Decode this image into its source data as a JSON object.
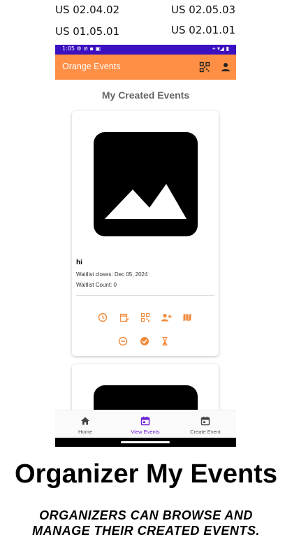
{
  "requirements": [
    "US 02.04.02",
    "US 02.05.03",
    "US 01.05.01",
    "US 02.01.01"
  ],
  "statusbar": {
    "time": "1:05",
    "left_icons": "⚙ ⊘ ▪ ▣",
    "right_icons": "⌖ ▾◢ ▮"
  },
  "appbar": {
    "title": "Orange Events",
    "qr_icon": "qr-code-icon",
    "profile_icon": "person-icon",
    "color": "#ff8f45"
  },
  "page": {
    "heading": "My Created Events"
  },
  "events": [
    {
      "name": "hi",
      "waitlist_closes": "Waitlist closes: Dec 05, 2024",
      "waitlist_count": "Waitlist Count: 0"
    }
  ],
  "actions": [
    "clock-icon",
    "edit-calendar-icon",
    "qr-code-icon",
    "add-person-icon",
    "map-icon",
    "remove-circle-icon",
    "check-circle-icon",
    "hourglass-icon"
  ],
  "accent": "#f08a3c",
  "nav": {
    "items": [
      {
        "label": "Home",
        "icon": "home-icon"
      },
      {
        "label": "View Events",
        "icon": "calendar-icon",
        "active": true
      },
      {
        "label": "Create Event",
        "icon": "calendar-icon"
      }
    ],
    "active_color": "#6a1bd8"
  },
  "caption": {
    "title": "Organizer My Events",
    "line1": "ORGANIZERS CAN BROWSE AND",
    "line2": "MANAGE THEIR CREATED EVENTS."
  }
}
